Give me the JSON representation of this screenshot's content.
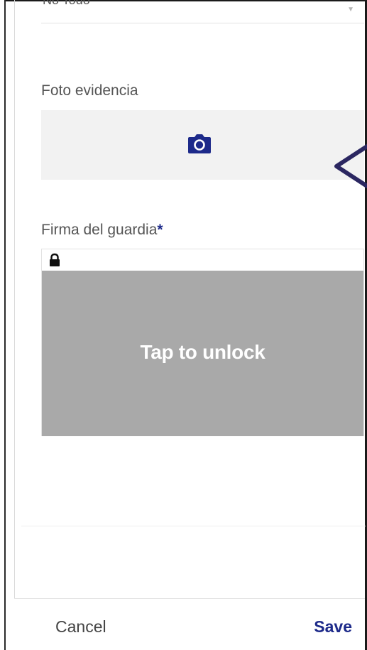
{
  "top_select": {
    "value": "No Todo"
  },
  "photo_field": {
    "label": "Foto evidencia",
    "icon": "camera-icon"
  },
  "signature_field": {
    "label": "Firma del guardia",
    "required_marker": "*",
    "lock_icon": "lock-icon",
    "unlock_prompt": "Tap to unlock"
  },
  "footer": {
    "cancel_label": "Cancel",
    "save_label": "Save"
  },
  "colors": {
    "accent": "#1d2a8a",
    "canvas_locked": "#a9a9a9",
    "photo_bg": "#f2f2f2",
    "annotation_arrow": "#2b2761"
  }
}
